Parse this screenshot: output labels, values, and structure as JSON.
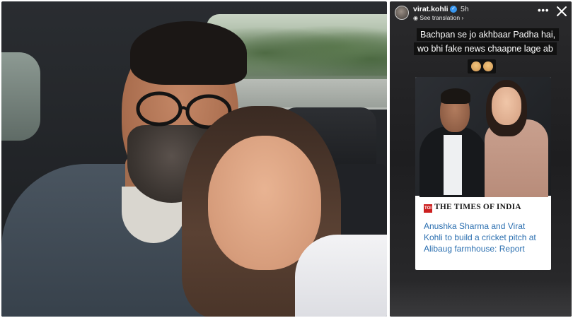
{
  "story": {
    "username": "virat.kohli",
    "verified_icon": "verified-badge-icon",
    "time": "5h",
    "see_translation": "See translation",
    "caption": {
      "line1": "Bachpan se jo akhbaar Padha hai,",
      "line2": "wo bhi fake news chaapne lage ab"
    },
    "icons": [
      "more-options-icon",
      "close-icon",
      "facepalm-emoji-icon",
      "shrug-emoji-icon"
    ]
  },
  "news_card": {
    "brand": "THE TIMES OF INDIA",
    "logo_text": "TOI",
    "headline": "Anushka Sharma and Virat Kohli to build a cricket pitch at Alibaug farmhouse: Report",
    "brand_color": "#cc1f1f",
    "headline_color": "#2b6fb0"
  },
  "colors": {
    "story_bg": "#252527",
    "caption_bg": "#111111",
    "verified": "#3897f0"
  }
}
